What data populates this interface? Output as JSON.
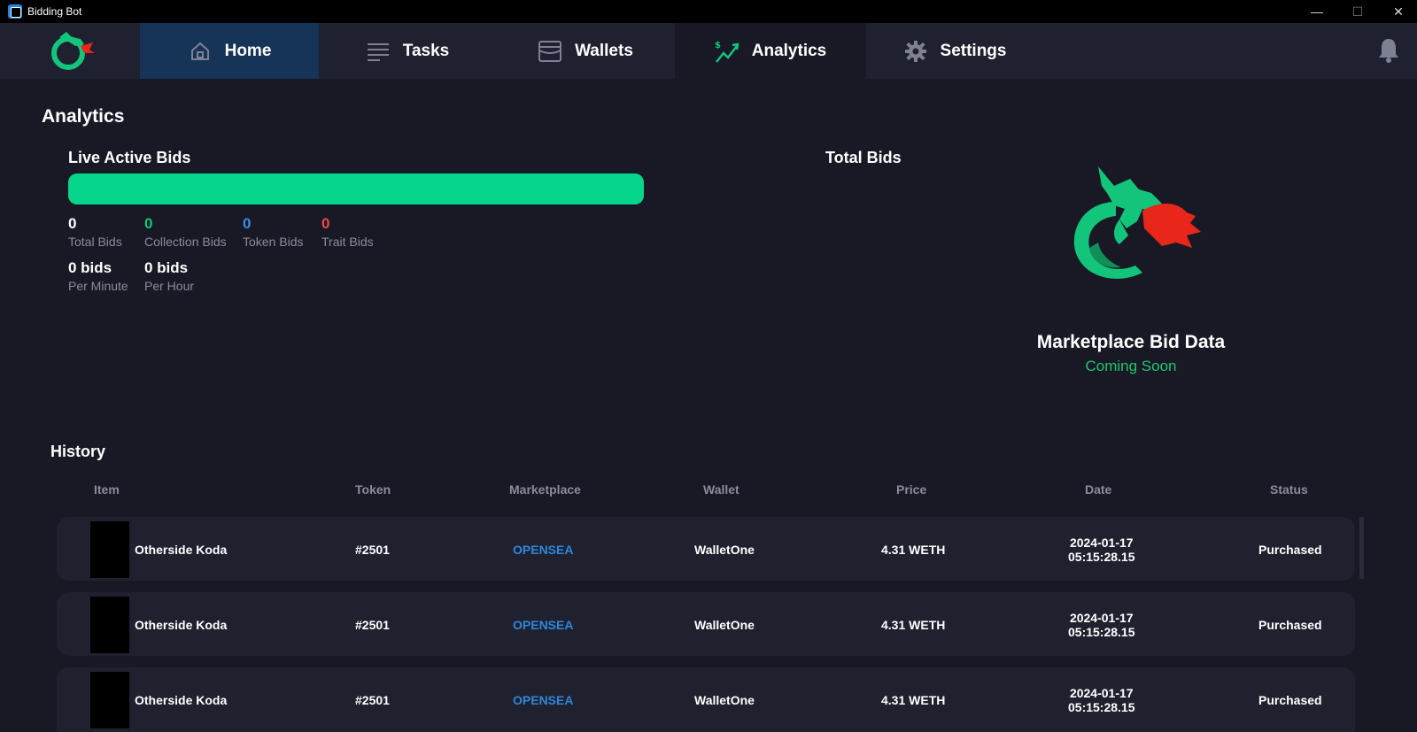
{
  "window": {
    "title": "Bidding Bot",
    "controls": [
      "—",
      "☐",
      "✕"
    ]
  },
  "nav": {
    "tabs": [
      {
        "label": "Home",
        "icon": "home-icon"
      },
      {
        "label": "Tasks",
        "icon": "list-icon"
      },
      {
        "label": "Wallets",
        "icon": "wallet-icon"
      },
      {
        "label": "Analytics",
        "icon": "analytics-icon",
        "active": true
      },
      {
        "label": "Settings",
        "icon": "gear-icon"
      }
    ],
    "logo": "dragon-logo",
    "notifications_icon": "bell-icon"
  },
  "analytics": {
    "title": "Analytics",
    "live_active_bids": {
      "title": "Live Active Bids",
      "stats": [
        {
          "value": "0",
          "label": "Total Bids"
        },
        {
          "value": "0",
          "label": "Collection Bids"
        },
        {
          "value": "0",
          "label": "Token Bids"
        },
        {
          "value": "0",
          "label": "Trait Bids"
        }
      ],
      "rates": [
        {
          "value": "0 bids",
          "label": "Per Minute"
        },
        {
          "value": "0 bids",
          "label": "Per Hour"
        }
      ]
    },
    "total_bids": {
      "title": "Total Bids",
      "placeholder_title": "Marketplace Bid Data",
      "placeholder_sub": "Coming Soon"
    }
  },
  "history": {
    "title": "History",
    "columns": [
      "Item",
      "Token",
      "Marketplace",
      "Wallet",
      "Price",
      "Date",
      "Status"
    ],
    "rows": [
      {
        "item": "Otherside Koda",
        "token": "#2501",
        "marketplace": "OPENSEA",
        "wallet": "WalletOne",
        "price": "4.31 WETH",
        "date": "2024-01-17",
        "time": "05:15:28.15",
        "status": "Purchased"
      },
      {
        "item": "Otherside Koda",
        "token": "#2501",
        "marketplace": "OPENSEA",
        "wallet": "WalletOne",
        "price": "4.31 WETH",
        "date": "2024-01-17",
        "time": "05:15:28.15",
        "status": "Purchased"
      },
      {
        "item": "Otherside Koda",
        "token": "#2501",
        "marketplace": "OPENSEA",
        "wallet": "WalletOne",
        "price": "4.31 WETH",
        "date": "2024-01-17",
        "time": "05:15:28.15",
        "status": "Purchased"
      }
    ]
  },
  "colors": {
    "accent": "#06d68b",
    "active_tab": "#153458",
    "marketplace_link": "#2f86dc",
    "coming_soon": "#1fc670",
    "trait": "#e84a4a"
  }
}
